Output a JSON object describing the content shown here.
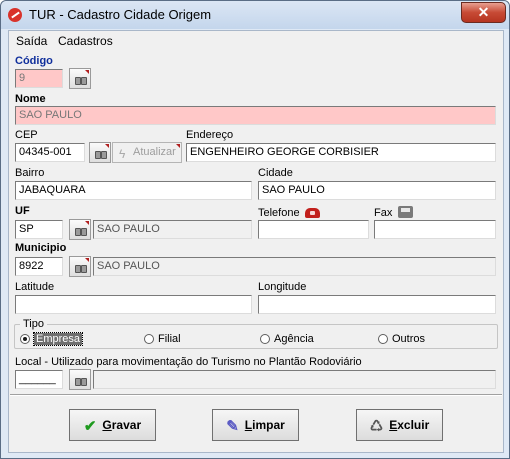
{
  "window": {
    "title": "TUR - Cadastro Cidade Origem",
    "close_label": "✕"
  },
  "menu": [
    "Saída",
    "Cadastros"
  ],
  "codigo": {
    "label": "Código",
    "value": "9"
  },
  "nome": {
    "label": "Nome",
    "value": "SAO PAULO"
  },
  "cep": {
    "label": "CEP",
    "value": "04345-001",
    "atualizar_label": "Atualizar"
  },
  "endereco": {
    "label": "Endereço",
    "value": "ENGENHEIRO GEORGE CORBISIER"
  },
  "bairro": {
    "label": "Bairro",
    "value": "JABAQUARA"
  },
  "cidade": {
    "label": "Cidade",
    "value": "SAO PAULO"
  },
  "uf": {
    "label": "UF",
    "value": "SP",
    "name": "SAO PAULO"
  },
  "telefone": {
    "label": "Telefone",
    "value": ""
  },
  "fax": {
    "label": "Fax",
    "value": ""
  },
  "municipio": {
    "label": "Municipio",
    "value": "8922",
    "name": "SAO PAULO"
  },
  "latitude": {
    "label": "Latitude",
    "value": ""
  },
  "longitude": {
    "label": "Longitude",
    "value": ""
  },
  "tipo": {
    "label": "Tipo",
    "options": [
      "Empresa",
      "Filial",
      "Agência",
      "Outros"
    ],
    "selected": "Empresa"
  },
  "local": {
    "label": "Local - Utilizado para movimentação do Turismo no Plantão Rodoviário",
    "value": "______",
    "name": ""
  },
  "buttons": {
    "gravar": [
      "G",
      "ravar"
    ],
    "limpar": [
      "L",
      "impar"
    ],
    "excluir": [
      "E",
      "xcluir"
    ]
  },
  "colors": {
    "required_bg": "#ffc8c8",
    "bold_label_blue": "#102f9c",
    "selected_radio_bg": "#6f6f6f"
  }
}
